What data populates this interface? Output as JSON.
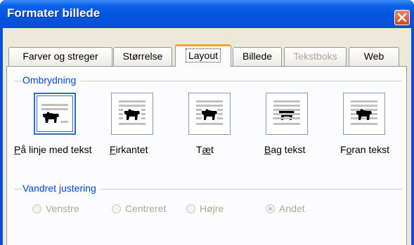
{
  "window": {
    "title": "Formater billede"
  },
  "tabs": [
    {
      "label": "Farver og streger",
      "state": "normal"
    },
    {
      "label": "Størrelse",
      "state": "normal"
    },
    {
      "label": "Layout",
      "state": "selected"
    },
    {
      "label": "Billede",
      "state": "normal"
    },
    {
      "label": "Tekstboks",
      "state": "disabled"
    },
    {
      "label": "Web",
      "state": "normal"
    }
  ],
  "wrapping": {
    "group_label": "Ombrydning",
    "options": [
      {
        "label": "På linje med tekst",
        "access_key": "P",
        "icon": "inline-with-text-icon",
        "selected": true
      },
      {
        "label": "Firkantet",
        "access_key": "F",
        "icon": "square-wrap-icon",
        "selected": false
      },
      {
        "label": "Tæt",
        "access_key": "T",
        "icon": "tight-wrap-icon",
        "selected": false
      },
      {
        "label": "Bag tekst",
        "access_key": "B",
        "icon": "behind-text-icon",
        "selected": false
      },
      {
        "label": "Foran tekst",
        "access_key": "o",
        "icon": "in-front-of-text-icon",
        "selected": false
      }
    ]
  },
  "alignment": {
    "group_label": "Vandret justering",
    "options": [
      {
        "label": "Venstre",
        "checked": false
      },
      {
        "label": "Centreret",
        "checked": false
      },
      {
        "label": "Højre",
        "checked": false
      },
      {
        "label": "Andet",
        "checked": true
      }
    ]
  },
  "colors": {
    "title_bar": "#0454dd",
    "dialog_face": "#ece9d8",
    "group_label": "#0046d5",
    "tab_highlight": "#f5a626",
    "close_button": "#d0461c"
  }
}
